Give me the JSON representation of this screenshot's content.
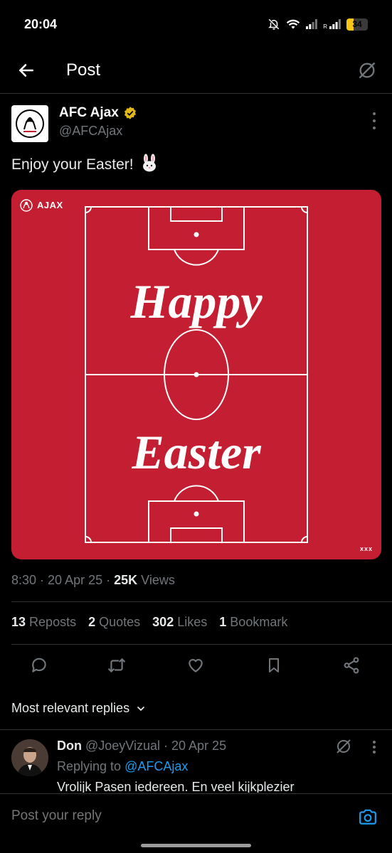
{
  "status_bar": {
    "time": "20:04",
    "battery": "34",
    "battery_level": 0.34,
    "roaming": "R"
  },
  "header": {
    "title": "Post"
  },
  "post": {
    "author_name": "AFC Ajax",
    "author_handle": "@AFCAjax",
    "text": "Enjoy your Easter!",
    "emoji": "rabbit-face",
    "image": {
      "logo_text": "AJAX",
      "line1": "Happy",
      "line2": "Easter",
      "corner_mark": "xxx"
    },
    "time": "8:30",
    "date": "20 Apr 25",
    "views_count": "25K",
    "views_label": "Views"
  },
  "stats": {
    "reposts_count": "13",
    "reposts_label": "Reposts",
    "quotes_count": "2",
    "quotes_label": "Quotes",
    "likes_count": "302",
    "likes_label": "Likes",
    "bookmarks_count": "1",
    "bookmarks_label": "Bookmark"
  },
  "actions": [
    "reply-icon",
    "repost-icon",
    "like-icon",
    "bookmark-icon",
    "share-icon"
  ],
  "replies_filter": {
    "label": "Most relevant replies"
  },
  "reply": {
    "name": "Don",
    "handle": "@JoeyVizual",
    "date": "20 Apr 25",
    "replying_label": "Replying to",
    "replying_to": "@AFCAjax",
    "text": "Vrolijk Pasen iedereen. En veel kijkplezier"
  },
  "composer": {
    "placeholder": "Post your reply"
  },
  "colors": {
    "accent": "#1d9bf0",
    "image_red": "#c41e32",
    "verified": "#e2b719"
  }
}
